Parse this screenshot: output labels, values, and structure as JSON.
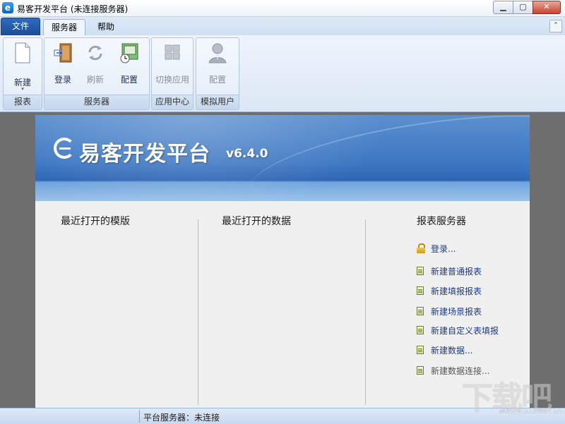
{
  "window": {
    "title": "易客开发平台 (未连接服务器)",
    "app_icon_glyph": "e",
    "controls": {
      "minimize": "▁",
      "maximize": "▢",
      "close": "✕"
    }
  },
  "ribbon": {
    "file_tab": "文件",
    "tabs": [
      "服务器",
      "帮助"
    ],
    "active_tab": "服务器",
    "collapse_glyph": "⌃",
    "groups": [
      {
        "label": "报表",
        "buttons": [
          {
            "label": "新建",
            "icon": "new-document-icon",
            "enabled": true,
            "dropdown": "▾"
          }
        ]
      },
      {
        "label": "服务器",
        "buttons": [
          {
            "label": "登录",
            "icon": "login-door-icon",
            "enabled": true
          },
          {
            "label": "刷新",
            "icon": "refresh-icon",
            "enabled": false
          },
          {
            "label": "配置",
            "icon": "server-config-icon",
            "enabled": true
          }
        ]
      },
      {
        "label": "应用中心",
        "buttons": [
          {
            "label": "切换应用",
            "icon": "switch-app-icon",
            "enabled": false
          }
        ]
      },
      {
        "label": "模拟用户",
        "buttons": [
          {
            "label": "配置",
            "icon": "user-avatar-icon",
            "enabled": false
          }
        ]
      }
    ]
  },
  "banner": {
    "brand": "易客开发平台",
    "version": "v6.4.0"
  },
  "sections": {
    "recent_templates": "最近打开的模版",
    "recent_data": "最近打开的数据",
    "report_server": "报表服务器"
  },
  "server_links": [
    {
      "label": "登录...",
      "icon": "lock-icon",
      "enabled": true
    },
    {
      "label": "新建普通报表",
      "icon": "report-doc-icon",
      "enabled": true
    },
    {
      "label": "新建填报报表",
      "icon": "report-doc-icon",
      "enabled": true
    },
    {
      "label": "新建场景报表",
      "icon": "report-doc-icon",
      "enabled": true
    },
    {
      "label": "新建自定义表填报",
      "icon": "report-doc-icon",
      "enabled": true
    },
    {
      "label": "新建数据...",
      "icon": "report-doc-icon",
      "enabled": true
    },
    {
      "label": "新建数据连接...",
      "icon": "report-doc-icon",
      "enabled": false
    }
  ],
  "status": {
    "platform_server": "平台服务器：未连接"
  },
  "watermark": {
    "text": "下载吧",
    "sub": "www.xiazaiba.com"
  }
}
